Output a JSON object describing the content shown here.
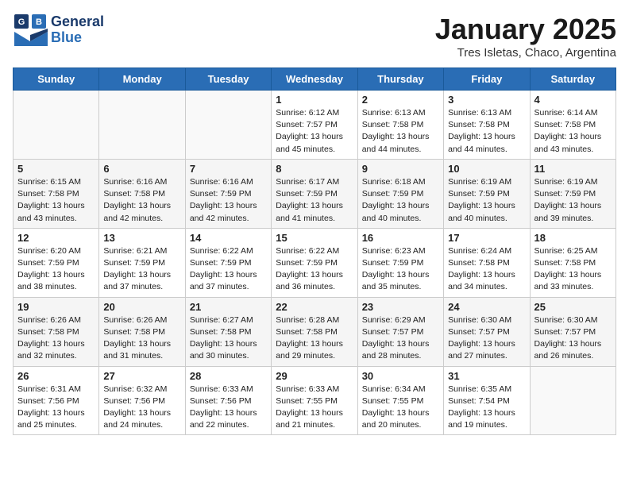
{
  "header": {
    "logo_line1": "General",
    "logo_line2": "Blue",
    "month_year": "January 2025",
    "location": "Tres Isletas, Chaco, Argentina"
  },
  "weekdays": [
    "Sunday",
    "Monday",
    "Tuesday",
    "Wednesday",
    "Thursday",
    "Friday",
    "Saturday"
  ],
  "weeks": [
    [
      {
        "day": "",
        "info": ""
      },
      {
        "day": "",
        "info": ""
      },
      {
        "day": "",
        "info": ""
      },
      {
        "day": "1",
        "info": "Sunrise: 6:12 AM\nSunset: 7:57 PM\nDaylight: 13 hours\nand 45 minutes."
      },
      {
        "day": "2",
        "info": "Sunrise: 6:13 AM\nSunset: 7:58 PM\nDaylight: 13 hours\nand 44 minutes."
      },
      {
        "day": "3",
        "info": "Sunrise: 6:13 AM\nSunset: 7:58 PM\nDaylight: 13 hours\nand 44 minutes."
      },
      {
        "day": "4",
        "info": "Sunrise: 6:14 AM\nSunset: 7:58 PM\nDaylight: 13 hours\nand 43 minutes."
      }
    ],
    [
      {
        "day": "5",
        "info": "Sunrise: 6:15 AM\nSunset: 7:58 PM\nDaylight: 13 hours\nand 43 minutes."
      },
      {
        "day": "6",
        "info": "Sunrise: 6:16 AM\nSunset: 7:58 PM\nDaylight: 13 hours\nand 42 minutes."
      },
      {
        "day": "7",
        "info": "Sunrise: 6:16 AM\nSunset: 7:59 PM\nDaylight: 13 hours\nand 42 minutes."
      },
      {
        "day": "8",
        "info": "Sunrise: 6:17 AM\nSunset: 7:59 PM\nDaylight: 13 hours\nand 41 minutes."
      },
      {
        "day": "9",
        "info": "Sunrise: 6:18 AM\nSunset: 7:59 PM\nDaylight: 13 hours\nand 40 minutes."
      },
      {
        "day": "10",
        "info": "Sunrise: 6:19 AM\nSunset: 7:59 PM\nDaylight: 13 hours\nand 40 minutes."
      },
      {
        "day": "11",
        "info": "Sunrise: 6:19 AM\nSunset: 7:59 PM\nDaylight: 13 hours\nand 39 minutes."
      }
    ],
    [
      {
        "day": "12",
        "info": "Sunrise: 6:20 AM\nSunset: 7:59 PM\nDaylight: 13 hours\nand 38 minutes."
      },
      {
        "day": "13",
        "info": "Sunrise: 6:21 AM\nSunset: 7:59 PM\nDaylight: 13 hours\nand 37 minutes."
      },
      {
        "day": "14",
        "info": "Sunrise: 6:22 AM\nSunset: 7:59 PM\nDaylight: 13 hours\nand 37 minutes."
      },
      {
        "day": "15",
        "info": "Sunrise: 6:22 AM\nSunset: 7:59 PM\nDaylight: 13 hours\nand 36 minutes."
      },
      {
        "day": "16",
        "info": "Sunrise: 6:23 AM\nSunset: 7:59 PM\nDaylight: 13 hours\nand 35 minutes."
      },
      {
        "day": "17",
        "info": "Sunrise: 6:24 AM\nSunset: 7:58 PM\nDaylight: 13 hours\nand 34 minutes."
      },
      {
        "day": "18",
        "info": "Sunrise: 6:25 AM\nSunset: 7:58 PM\nDaylight: 13 hours\nand 33 minutes."
      }
    ],
    [
      {
        "day": "19",
        "info": "Sunrise: 6:26 AM\nSunset: 7:58 PM\nDaylight: 13 hours\nand 32 minutes."
      },
      {
        "day": "20",
        "info": "Sunrise: 6:26 AM\nSunset: 7:58 PM\nDaylight: 13 hours\nand 31 minutes."
      },
      {
        "day": "21",
        "info": "Sunrise: 6:27 AM\nSunset: 7:58 PM\nDaylight: 13 hours\nand 30 minutes."
      },
      {
        "day": "22",
        "info": "Sunrise: 6:28 AM\nSunset: 7:58 PM\nDaylight: 13 hours\nand 29 minutes."
      },
      {
        "day": "23",
        "info": "Sunrise: 6:29 AM\nSunset: 7:57 PM\nDaylight: 13 hours\nand 28 minutes."
      },
      {
        "day": "24",
        "info": "Sunrise: 6:30 AM\nSunset: 7:57 PM\nDaylight: 13 hours\nand 27 minutes."
      },
      {
        "day": "25",
        "info": "Sunrise: 6:30 AM\nSunset: 7:57 PM\nDaylight: 13 hours\nand 26 minutes."
      }
    ],
    [
      {
        "day": "26",
        "info": "Sunrise: 6:31 AM\nSunset: 7:56 PM\nDaylight: 13 hours\nand 25 minutes."
      },
      {
        "day": "27",
        "info": "Sunrise: 6:32 AM\nSunset: 7:56 PM\nDaylight: 13 hours\nand 24 minutes."
      },
      {
        "day": "28",
        "info": "Sunrise: 6:33 AM\nSunset: 7:56 PM\nDaylight: 13 hours\nand 22 minutes."
      },
      {
        "day": "29",
        "info": "Sunrise: 6:33 AM\nSunset: 7:55 PM\nDaylight: 13 hours\nand 21 minutes."
      },
      {
        "day": "30",
        "info": "Sunrise: 6:34 AM\nSunset: 7:55 PM\nDaylight: 13 hours\nand 20 minutes."
      },
      {
        "day": "31",
        "info": "Sunrise: 6:35 AM\nSunset: 7:54 PM\nDaylight: 13 hours\nand 19 minutes."
      },
      {
        "day": "",
        "info": ""
      }
    ]
  ]
}
